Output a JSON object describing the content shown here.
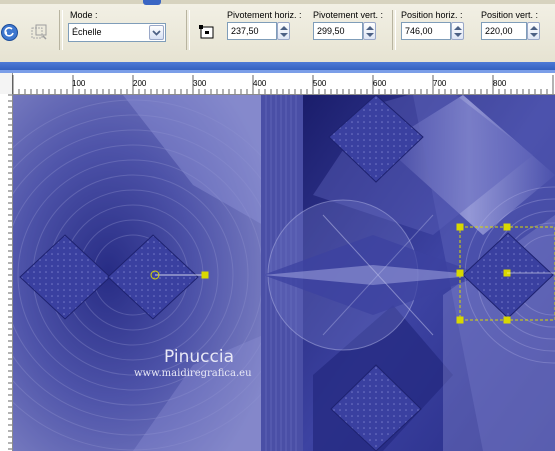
{
  "toolbar": {
    "mode_label": "Mode :",
    "mode_value": "Échelle",
    "pivot_h_label": "Pivotement horiz. :",
    "pivot_h_value": "237,50",
    "pivot_v_label": "Pivotement vert. :",
    "pivot_v_value": "299,50",
    "pos_h_label": "Position horiz. :",
    "pos_h_value": "746,00",
    "pos_v_label": "Position vert. :",
    "pos_v_value": "220,00"
  },
  "ruler": {
    "h_labels": [
      "100",
      "200",
      "300",
      "400",
      "500",
      "600",
      "700",
      "800"
    ]
  },
  "canvas": {
    "watermark_name": "Pinuccia",
    "watermark_url": "www.maidiregrafica.eu"
  },
  "colors": {
    "deep": "#1b1e6e",
    "mid": "#5157b0",
    "light": "#c6c8f0",
    "handle": "#d8d800"
  }
}
